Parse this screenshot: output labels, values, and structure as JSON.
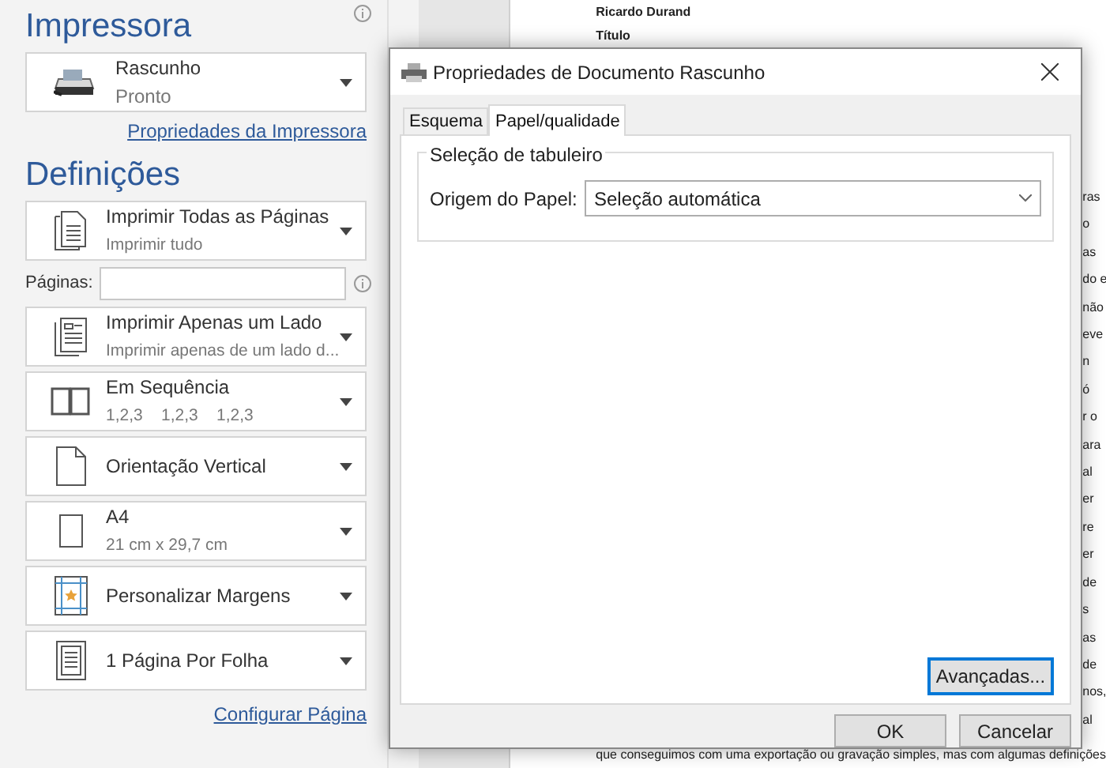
{
  "printer": {
    "title": "Impressora",
    "device": {
      "name": "Rascunho",
      "status": "Pronto"
    },
    "link": "Propriedades da Impressora"
  },
  "settings": {
    "title": "Definições",
    "items": [
      {
        "kind": "dropdown",
        "primary": "Imprimir Todas as Páginas",
        "secondary": "Imprimir tudo"
      },
      {
        "kind": "field",
        "label": "Páginas:"
      },
      {
        "kind": "dropdown",
        "primary": "Imprimir Apenas um Lado",
        "secondary": "Imprimir apenas de um lado d..."
      },
      {
        "kind": "dropdown",
        "primary": "Em Sequência",
        "secondary": "1,2,3    1,2,3    1,2,3"
      },
      {
        "kind": "dropdown",
        "primary": "Orientação Vertical"
      },
      {
        "kind": "dropdown",
        "primary": "A4",
        "secondary": "21 cm x 29,7 cm"
      },
      {
        "kind": "dropdown",
        "primary": "Personalizar Margens"
      },
      {
        "kind": "dropdown",
        "primary": "1 Página Por Folha"
      }
    ],
    "link": "Configurar Página"
  },
  "document": {
    "author": "Ricardo Durand",
    "heading": "Título",
    "edge_fragments": [
      "ras",
      "o",
      "as",
      "do e",
      "não",
      "eve",
      "n",
      "ó",
      "r o",
      "ara",
      "al",
      "er",
      "re",
      "er",
      "de",
      "s",
      "as",
      "de",
      "nos,",
      "al"
    ],
    "last_line": "que conseguimos com uma exportação ou gravação simples, mas com algumas definições"
  },
  "dialog": {
    "title": "Propriedades de Documento Rascunho",
    "tabs": [
      {
        "label": "Esquema",
        "selected": false
      },
      {
        "label": "Papel/qualidade",
        "selected": true
      }
    ],
    "group": {
      "title": "Seleção de tabuleiro",
      "label": "Origem do Papel:",
      "value": "Seleção automática"
    },
    "advanced_button": "Avançadas...",
    "buttons": [
      "OK",
      "Cancelar"
    ]
  }
}
